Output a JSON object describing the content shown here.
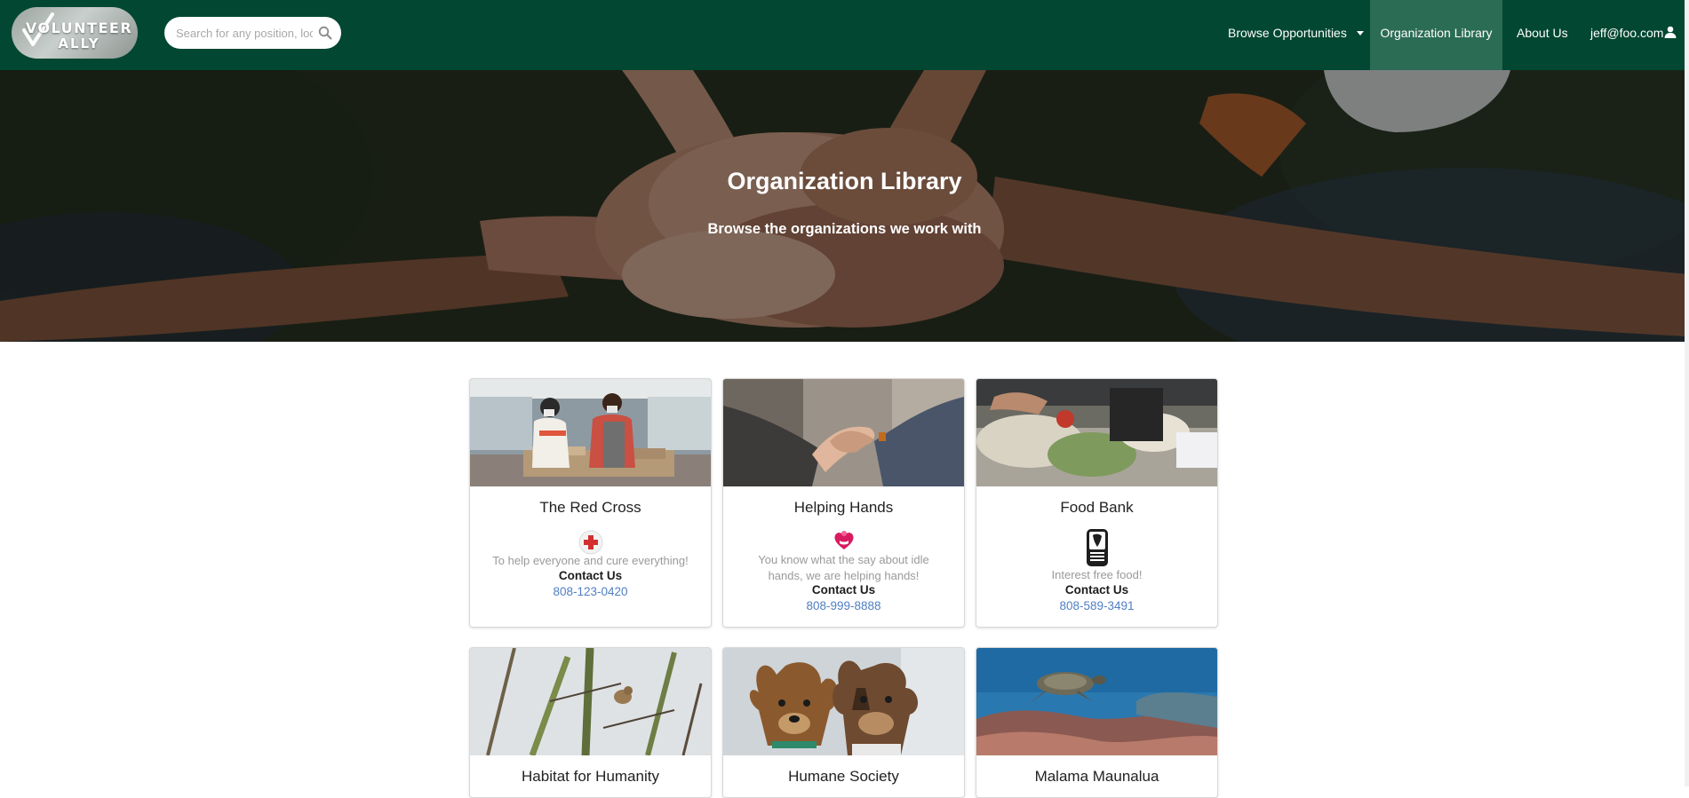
{
  "brand": {
    "logo_line1": "VOLUNTEER",
    "logo_line2": "ALLY"
  },
  "search": {
    "placeholder": "Search for any position, location...",
    "value": ""
  },
  "nav": {
    "browse": "Browse Opportunities",
    "library": "Organization Library",
    "about": "About Us",
    "user": "jeff@foo.com"
  },
  "hero": {
    "title": "Organization Library",
    "subtitle": "Browse the organizations we work with"
  },
  "organizations": [
    {
      "name": "The Red Cross",
      "icon": "red-cross-icon",
      "description": "To help everyone and cure everything!",
      "contact_label": "Contact Us",
      "phone": "808-123-0420"
    },
    {
      "name": "Helping Hands",
      "icon": "heart-hands-icon",
      "description": "You know what the say about idle hands, we are helping hands!",
      "contact_label": "Contact Us",
      "phone": "808-999-8888"
    },
    {
      "name": "Food Bank",
      "icon": "food-bank-logo-icon",
      "description": "Interest free food!",
      "contact_label": "Contact Us",
      "phone": "808-589-3491"
    },
    {
      "name": "Habitat for Humanity"
    },
    {
      "name": "Humane Society"
    },
    {
      "name": "Malama Maunalua"
    }
  ],
  "colors": {
    "navbar": "#024731",
    "nav_active": "#2b6c55",
    "link": "#4f7fc2",
    "red_cross": "#d32f2f",
    "helping_hands": "#d81b60"
  }
}
